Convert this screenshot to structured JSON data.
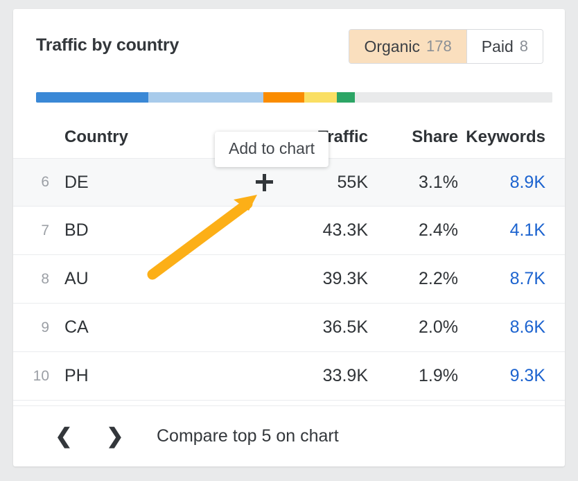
{
  "card": {
    "title": "Traffic by country"
  },
  "toggle": {
    "organic": {
      "label": "Organic",
      "count": "178"
    },
    "paid": {
      "label": "Paid",
      "count": "8"
    }
  },
  "bar": {
    "segments": [
      {
        "name": "segment-1",
        "color": "#3a88d6",
        "pct": 21.7
      },
      {
        "name": "segment-2",
        "color": "#a8cbeb",
        "pct": 22.3
      },
      {
        "name": "segment-3",
        "color": "#fa8c00",
        "pct": 8.0
      },
      {
        "name": "segment-4",
        "color": "#fadf63",
        "pct": 6.2
      },
      {
        "name": "segment-5",
        "color": "#2ca565",
        "pct": 3.5
      },
      {
        "name": "segment-rest",
        "color": "#e9eaeb",
        "pct": 38.3
      }
    ]
  },
  "table": {
    "columns": {
      "country": "Country",
      "traffic": "Traffic",
      "share": "Share",
      "keywords": "Keywords"
    },
    "rows": [
      {
        "rank": "6",
        "country": "DE",
        "traffic": "55K",
        "share": "3.1%",
        "keywords": "8.9K",
        "hovered": true
      },
      {
        "rank": "7",
        "country": "BD",
        "traffic": "43.3K",
        "share": "2.4%",
        "keywords": "4.1K",
        "hovered": false
      },
      {
        "rank": "8",
        "country": "AU",
        "traffic": "39.3K",
        "share": "2.2%",
        "keywords": "8.7K",
        "hovered": false
      },
      {
        "rank": "9",
        "country": "CA",
        "traffic": "36.5K",
        "share": "2.0%",
        "keywords": "8.6K",
        "hovered": false
      },
      {
        "rank": "10",
        "country": "PH",
        "traffic": "33.9K",
        "share": "1.9%",
        "keywords": "9.3K",
        "hovered": false
      }
    ]
  },
  "tooltip": {
    "text": "Add to chart"
  },
  "footer": {
    "prev_icon": "❮",
    "next_icon": "❯",
    "label": "Compare top 5 on chart"
  },
  "annotation": {
    "arrow_color": "#fcaf17"
  },
  "colors": {
    "page_background": "#e9eaeb",
    "card_background": "#ffffff",
    "active_tab": "#fadfbe",
    "link": "#1c63cf",
    "row_hover": "#f7f8f9"
  }
}
